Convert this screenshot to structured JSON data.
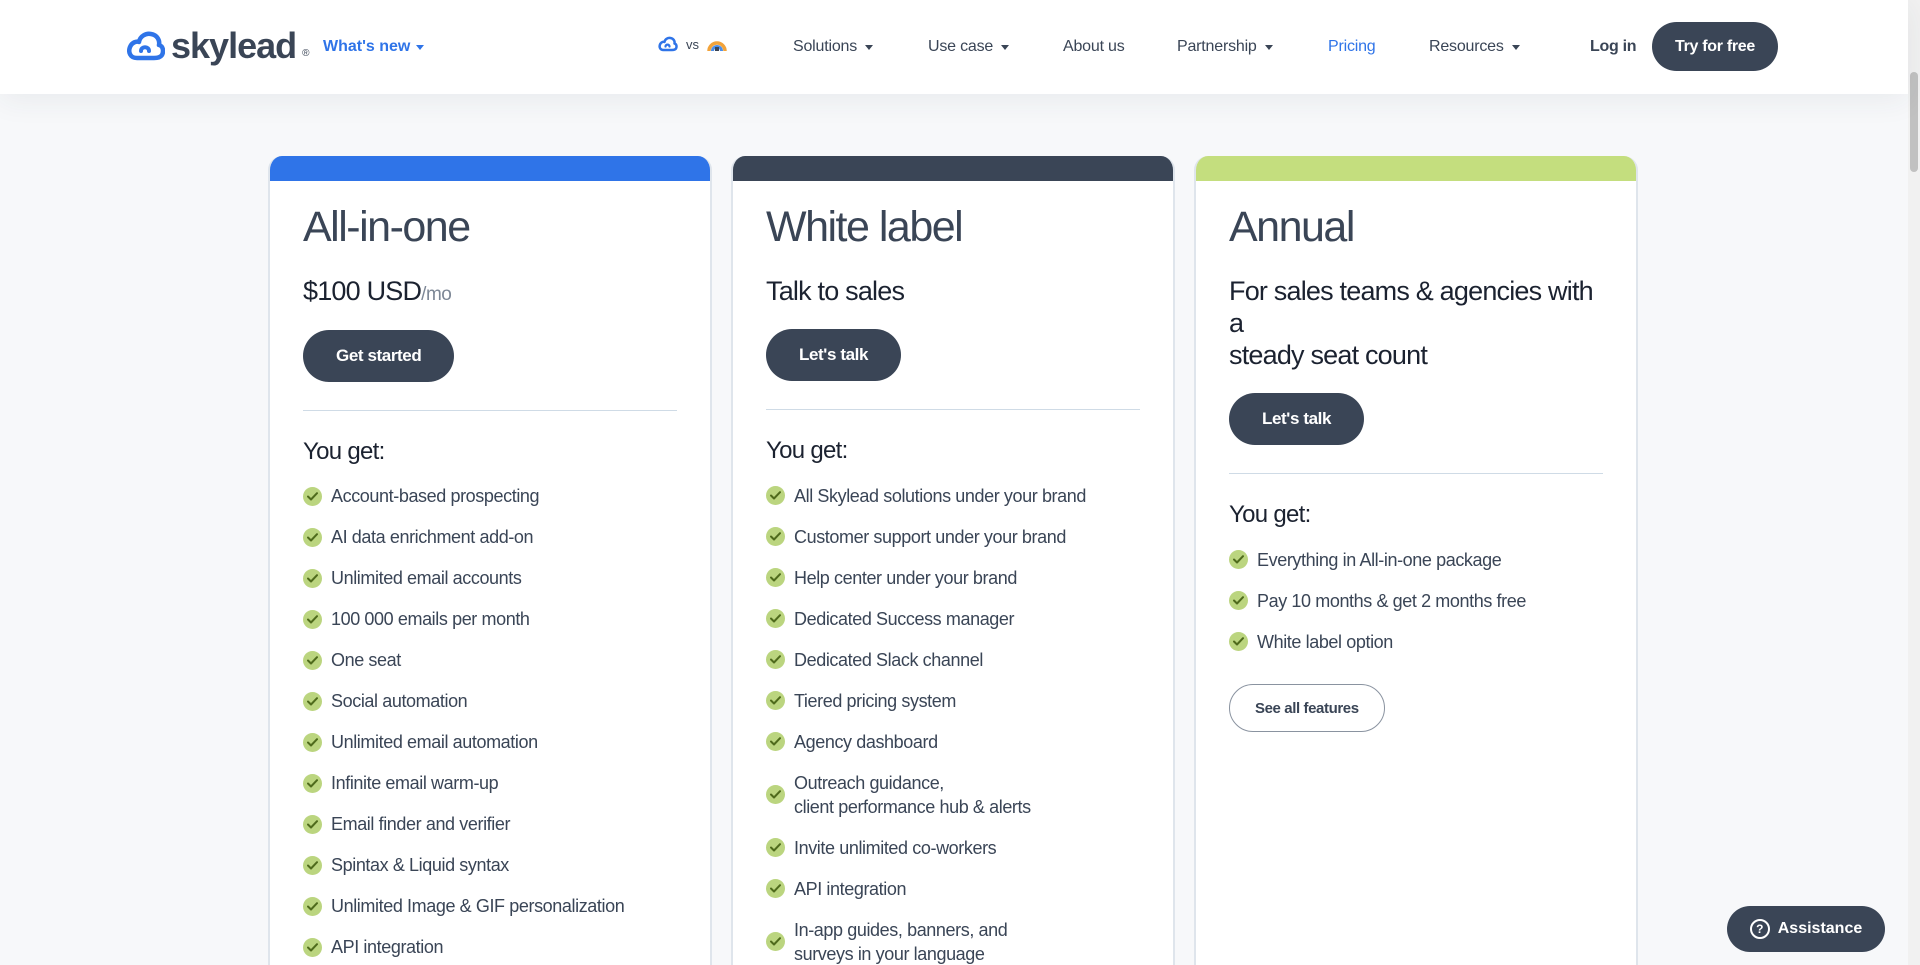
{
  "header": {
    "logo_text": "skylead",
    "whats_new": "What's new",
    "vs_label": "vs",
    "nav": {
      "solutions": "Solutions",
      "use_case": "Use case",
      "about": "About us",
      "partnership": "Partnership",
      "pricing": "Pricing",
      "resources": "Resources"
    },
    "login": "Log in",
    "try_free": "Try for free"
  },
  "colors": {
    "brand_blue": "#2f74e8",
    "dark_slate": "#3a4556",
    "lime": "#c4de7e",
    "check_green": "#bbd57f"
  },
  "cards": [
    {
      "title": "All-in-one",
      "price": "$100 USD",
      "price_unit": "/mo",
      "button": "Get started",
      "you_get": "You get:",
      "features": [
        "Account-based prospecting",
        "AI data enrichment add-on",
        "Unlimited email accounts",
        "100 000 emails per month",
        "One seat",
        "Social automation",
        "Unlimited email automation",
        "Infinite email warm-up",
        "Email finder and verifier",
        "Spintax & Liquid syntax",
        "Unlimited Image & GIF personalization",
        "API integration"
      ]
    },
    {
      "title": "White label",
      "subtitle": "Talk to sales",
      "button": "Let's talk",
      "you_get": "You get:",
      "features": [
        "All Skylead solutions under your brand",
        "Customer support under your brand",
        "Help center under your brand",
        "Dedicated Success manager",
        "Dedicated Slack channel",
        "Tiered pricing system",
        "Agency dashboard",
        [
          "Outreach guidance,",
          "client performance hub & alerts"
        ],
        "Invite unlimited co-workers",
        "API integration",
        [
          "In-app guides, banners, and",
          "surveys in your language"
        ]
      ]
    },
    {
      "title": "Annual",
      "subtitle_lines": [
        "For sales teams & agencies with a",
        "steady seat count"
      ],
      "button": "Let's talk",
      "you_get": "You get:",
      "features": [
        "Everything in All-in-one package",
        "Pay 10 months & get 2 months free",
        "White label option"
      ],
      "secondary_button": "See all features"
    }
  ],
  "assistance": "Assistance"
}
